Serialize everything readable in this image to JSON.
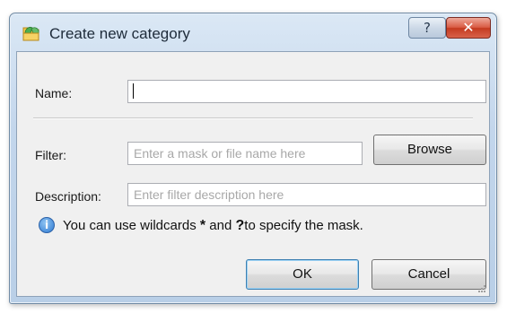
{
  "window": {
    "title": "Create new category",
    "help_label": "?",
    "close_label": "✕"
  },
  "form": {
    "name_label": "Name:",
    "name_value": "",
    "filter_label": "Filter:",
    "filter_placeholder": "Enter a mask or file name here",
    "browse_label": "Browse",
    "description_label": "Description:",
    "description_placeholder": "Enter filter description here"
  },
  "hint": {
    "text_1": "You can use wildcards",
    "wild_1": "*",
    "text_2": "and",
    "wild_2": "?",
    "text_3": "to specify the mask."
  },
  "buttons": {
    "ok": "OK",
    "cancel": "Cancel"
  },
  "icons": {
    "app": "folder-category-icon",
    "info": "info-icon",
    "help": "help-icon",
    "close": "close-icon",
    "grip": "resize-grip-icon"
  },
  "colors": {
    "frame": "#c3d6ec",
    "client": "#f0f0f0",
    "close": "#d95b44",
    "info": "#2f7ad2",
    "default_button_border": "#3c7fb1"
  }
}
